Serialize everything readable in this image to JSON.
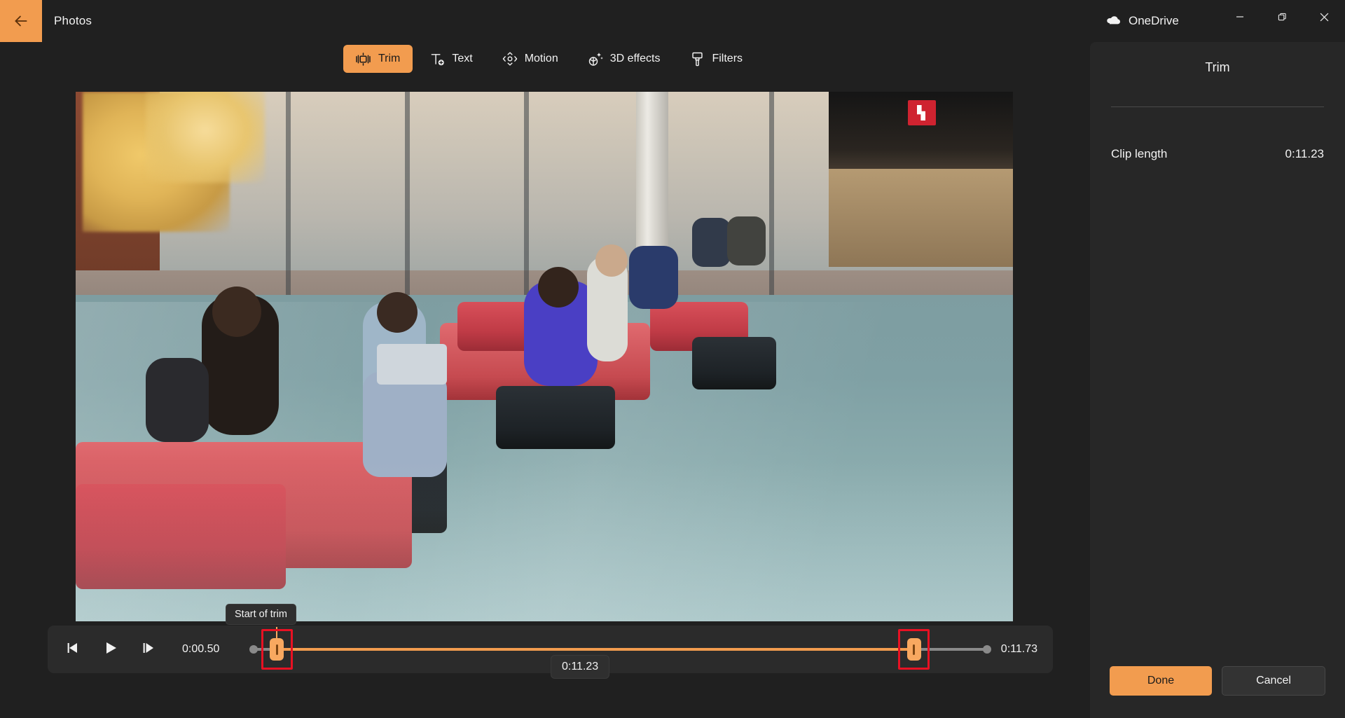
{
  "window": {
    "app_title": "Photos",
    "back_icon": "back-arrow-icon",
    "onedrive_label": "OneDrive",
    "onedrive_icon": "onedrive-cloud-icon",
    "minimize_icon": "minimize-icon",
    "maximize_icon": "restore-icon",
    "close_icon": "close-icon",
    "accent_color": "#F29C4F",
    "background_color": "#202020"
  },
  "toolbar": {
    "tabs": [
      {
        "label": "Trim",
        "icon": "trim-icon",
        "active": true
      },
      {
        "label": "Text",
        "icon": "text-add-icon",
        "active": false
      },
      {
        "label": "Motion",
        "icon": "motion-icon",
        "active": false
      },
      {
        "label": "3D effects",
        "icon": "3d-effects-icon",
        "active": false
      },
      {
        "label": "Filters",
        "icon": "filters-brush-icon",
        "active": false
      }
    ]
  },
  "player": {
    "prev_frame_icon": "previous-frame-icon",
    "play_icon": "play-icon",
    "next_frame_icon": "next-frame-icon",
    "current_time": "0:00.50",
    "end_time": "0:11.73",
    "duration_badge": "0:11.23",
    "start_handle_tooltip": "Start of trim",
    "start_handle_name": "trim-start-handle",
    "end_handle_name": "trim-end-handle",
    "track_fill_color": "#F29C4F",
    "track_rail_color": "#8a8a8a",
    "highlight_color": "#e81123"
  },
  "panel": {
    "title": "Trim",
    "clip_length_label": "Clip length",
    "clip_length_value": "0:11.23",
    "done_label": "Done",
    "cancel_label": "Cancel"
  }
}
